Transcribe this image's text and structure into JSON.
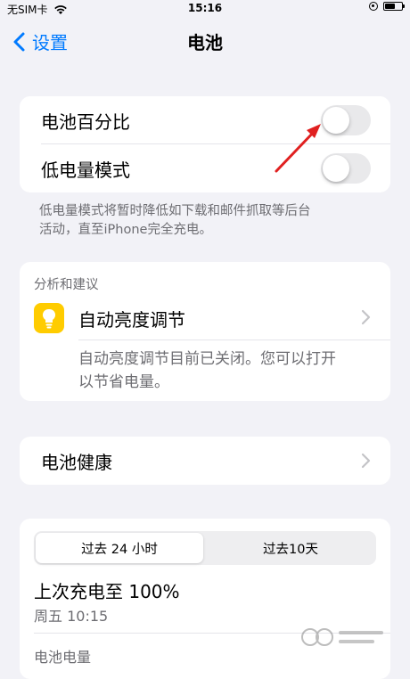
{
  "status": {
    "carrier": "无SIM卡",
    "time": "15:16"
  },
  "nav": {
    "back_label": "设置",
    "title": "电池"
  },
  "toggles": {
    "battery_percentage_label": "电池百分比",
    "low_power_label": "低电量模式"
  },
  "low_power_note": {
    "line1": "低电量模式将暂时降低如下载和邮件抓取等后台",
    "line2": "活动，直至iPhone完全充电。"
  },
  "insights": {
    "header": "分析和建议",
    "auto_brightness_label": "自动亮度调节",
    "auto_brightness_desc_line1": "自动亮度调节目前已关闭。您可以打开",
    "auto_brightness_desc_line2": "以节省电量。"
  },
  "health": {
    "label": "电池健康"
  },
  "usage": {
    "segments": [
      "过去 24 小时",
      "过去10天"
    ],
    "last_charge": "上次充电至 100%",
    "last_charge_time": "周五 10:15",
    "battery_level_label": "电池电量"
  },
  "colors": {
    "accent": "#007aff",
    "bulb": "#ffcc00",
    "annotation_arrow": "#e02020"
  }
}
